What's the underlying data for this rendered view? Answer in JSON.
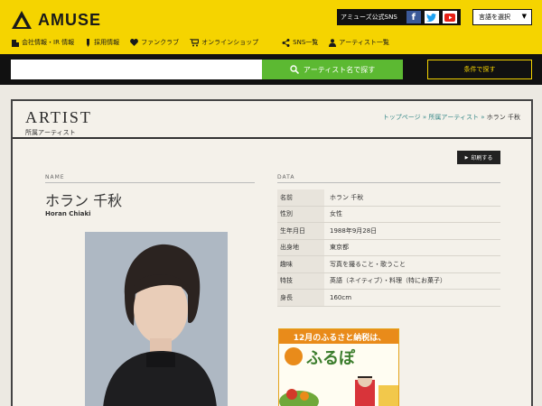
{
  "header": {
    "logo_text": "AMUSE",
    "sns_label": "アミューズ公式SNS",
    "sns_icons": [
      "facebook-icon",
      "twitter-icon",
      "youtube-icon"
    ],
    "lang_select": "言語を選択",
    "nav": [
      {
        "label": "会社情報・IR 情報",
        "icon": "building-icon"
      },
      {
        "label": "採用情報",
        "icon": "pen-icon"
      },
      {
        "label": "ファンクラブ",
        "icon": "heart-icon"
      },
      {
        "label": "オンラインショップ",
        "icon": "cart-icon"
      },
      {
        "label": "SNS一覧",
        "icon": "share-icon"
      },
      {
        "label": "アーティスト一覧",
        "icon": "person-icon"
      }
    ]
  },
  "search": {
    "placeholder": "",
    "button_label": "アーティスト名で探す",
    "condition_button": "条件で探す"
  },
  "artist": {
    "section_title": "ARTIST",
    "section_sub": "所属アーティスト",
    "breadcrumb": [
      "トップページ",
      "所属アーティスト",
      "ホラン 千秋"
    ],
    "print_button": "印刷する",
    "name_label": "NAME",
    "name_jp": "ホラン 千秋",
    "name_en": "Horan Chiaki",
    "data_label": "DATA",
    "data": [
      {
        "key": "名前",
        "value": "ホラン 千秋"
      },
      {
        "key": "性別",
        "value": "女性"
      },
      {
        "key": "生年月日",
        "value": "1988年9月28日"
      },
      {
        "key": "出身地",
        "value": "東京都"
      },
      {
        "key": "趣味",
        "value": "写真を撮ること・歌うこと"
      },
      {
        "key": "特技",
        "value": "英語（ネイティブ）・料理（特にお菓子）"
      },
      {
        "key": "身長",
        "value": "160cm"
      }
    ]
  },
  "banner": {
    "headline": "12月のふるさと納税は、",
    "brand": "ふるぽ"
  },
  "colors": {
    "brand_yellow": "#f5d400",
    "search_green": "#5cb932"
  }
}
